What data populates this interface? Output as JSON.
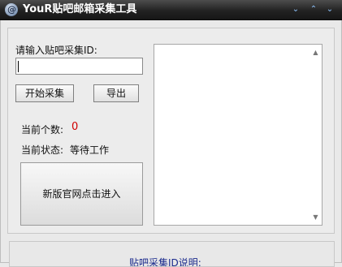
{
  "window": {
    "title": "YouR贴吧邮箱采集工具",
    "controls": [
      "⌄",
      "⌃",
      "⌄"
    ]
  },
  "form": {
    "id_label": "请输入贴吧采集ID:",
    "id_value": "",
    "start_button": "开始采集",
    "export_button": "导出",
    "count_label": "当前个数:",
    "count_value": "0",
    "status_label": "当前状态:",
    "status_value": "等待工作",
    "visit_button": "新版官网点击进入"
  },
  "output": {
    "scroll_up": "▲",
    "scroll_down": "▼"
  },
  "bottom": {
    "note_title": "贴吧采集ID说明:"
  },
  "colors": {
    "titlebar": "#222222",
    "count_value": "#d00000",
    "note_text": "#1a2a8c"
  }
}
